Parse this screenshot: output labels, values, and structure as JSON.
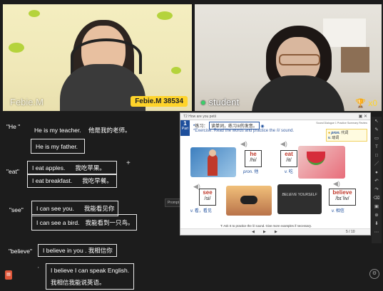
{
  "video": {
    "teacher": {
      "overlay_label": "Febie.M",
      "badge": "Febie.M 38534"
    },
    "student": {
      "label": "student",
      "star_count": "x0"
    }
  },
  "chat": {
    "entries": [
      {
        "type": "quote",
        "text": "\"He \""
      },
      {
        "type": "line",
        "en": "He is my teacher.",
        "zh": "他是我的老师。"
      },
      {
        "type": "box",
        "en": "He is my father.",
        "zh": ""
      },
      {
        "type": "quote",
        "text": "\"eat\""
      },
      {
        "type": "box",
        "en": "I eat apples.",
        "zh": "我吃苹果。"
      },
      {
        "type": "box",
        "en": "I eat breakfast.",
        "zh": "我吃早餐。"
      },
      {
        "type": "quote",
        "text": "\"see\""
      },
      {
        "type": "box",
        "en": "I can see you.",
        "zh": "我能看见你"
      },
      {
        "type": "box",
        "en": "I can see a bird.",
        "zh": "我能看到一只鸟。"
      },
      {
        "type": "quote",
        "text": "\"believe\""
      },
      {
        "type": "box",
        "en": "I believe in you . 我相信你",
        "zh": ""
      },
      {
        "type": "box2",
        "en": "I believe I can speak English.",
        "zh": "我相信我能说英语。"
      }
    ]
  },
  "slide": {
    "window_title": "T2 How are you petii",
    "part_number": "1",
    "part_label": "Part",
    "instruction_prefix": "练习：",
    "instruction_cn": "读单词，练习/i/的发音。",
    "instruction_en": "*Exercise: Read the words and practice the /i/ sound.",
    "tabs": "Sound   Dialogue 1   Practice   Summary   Review",
    "legend_pron": "pron.",
    "legend_pron_zh": "代词",
    "legend_v": "v.",
    "legend_v_zh": "动词",
    "words": [
      {
        "word": "he",
        "ipa": "/hi/",
        "pos": "pron.",
        "meaning": "他"
      },
      {
        "word": "eat",
        "ipa": "/it/",
        "pos": "v.",
        "meaning": "吃"
      },
      {
        "word": "see",
        "ipa": "/si/",
        "pos": "v.",
        "meaning": "看，看见"
      },
      {
        "word": "believe",
        "ipa": "/bɪˈliv/",
        "pos": "v.",
        "meaning": "相信"
      }
    ],
    "believe_image_text": "BELIEVE YOURSELF",
    "tip": "T: Ask S to practice the /i/ sound. Give more examples if necessary.",
    "page_indicator": "5 / 10",
    "prompt_tab": "Prompt"
  },
  "toolbar": {
    "icons": [
      "cursor-icon",
      "pen-icon",
      "eraser-icon",
      "text-icon",
      "shape-icon",
      "line-icon",
      "color-icon",
      "undo-icon",
      "redo-icon",
      "clear-icon",
      "image-icon",
      "zoom-icon",
      "save-icon",
      "more-icon"
    ]
  },
  "colors": {
    "background": "#1c1c1c",
    "accent_blue": "#1e4f9c",
    "word_red": "#c0392b",
    "badge_yellow": "#ffd42a"
  }
}
